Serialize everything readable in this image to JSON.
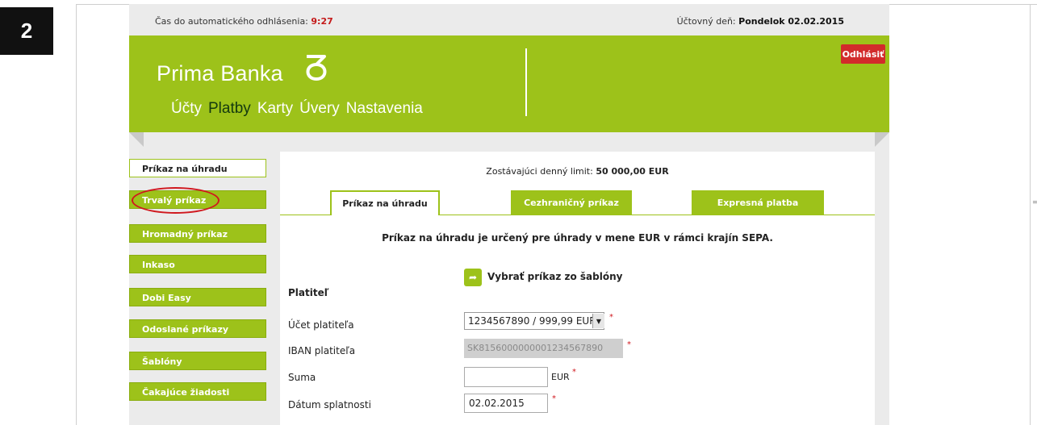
{
  "step_badge": "2",
  "topbar": {
    "logout_timer_label": "Čas do automatického odhlásenia:",
    "logout_timer_value": "9:27",
    "accounting_day_label": "Účtovný deň:",
    "accounting_day_value": "Pondelok 02.02.2015"
  },
  "header": {
    "logo": "Prima Banka",
    "logout_button": "Odhlásiť",
    "nav": [
      "Účty",
      "Platby",
      "Karty",
      "Úvery",
      "Nastavenia"
    ],
    "nav_active": "Platby"
  },
  "sidebar": {
    "items": [
      {
        "label": "Príkaz na úhradu",
        "active": true
      },
      {
        "label": "Trvalý príkaz",
        "highlighted": true
      },
      {
        "label": "Hromadný príkaz"
      },
      {
        "label": "Inkaso"
      },
      {
        "label": "Dobi Easy"
      },
      {
        "label": "Odoslané príkazy"
      },
      {
        "label": "Šablóny"
      },
      {
        "label": "Čakajúce žiadosti"
      }
    ]
  },
  "main": {
    "daily_limit_label": "Zostávajúci denný limit:",
    "daily_limit_value": "50 000,00 EUR",
    "tabs": [
      "Príkaz na úhradu",
      "Cezhraničný príkaz",
      "Expresná platba"
    ],
    "notice": "Príkaz na úhradu je určený pre úhrady v mene EUR v rámci krajín SEPA.",
    "template_link": "Vybrať príkaz zo šablóny",
    "payer_heading": "Platiteľ",
    "fields": {
      "account_label": "Účet platiteľa",
      "account_value": "1234567890 / 999,99 EUR",
      "iban_label": "IBAN platiteľa",
      "iban_value": "SK8156000000001234567890",
      "amount_label": "Suma",
      "amount_value": "",
      "amount_unit": "EUR",
      "due_date_label": "Dátum splatnosti",
      "due_date_value": "02.02.2015"
    },
    "required_marker": "*"
  },
  "colors": {
    "brand_green": "#9dc21a",
    "logout_red": "#d22b2b",
    "timer_red": "#c41a1a",
    "highlight_circle": "#d0181e"
  }
}
